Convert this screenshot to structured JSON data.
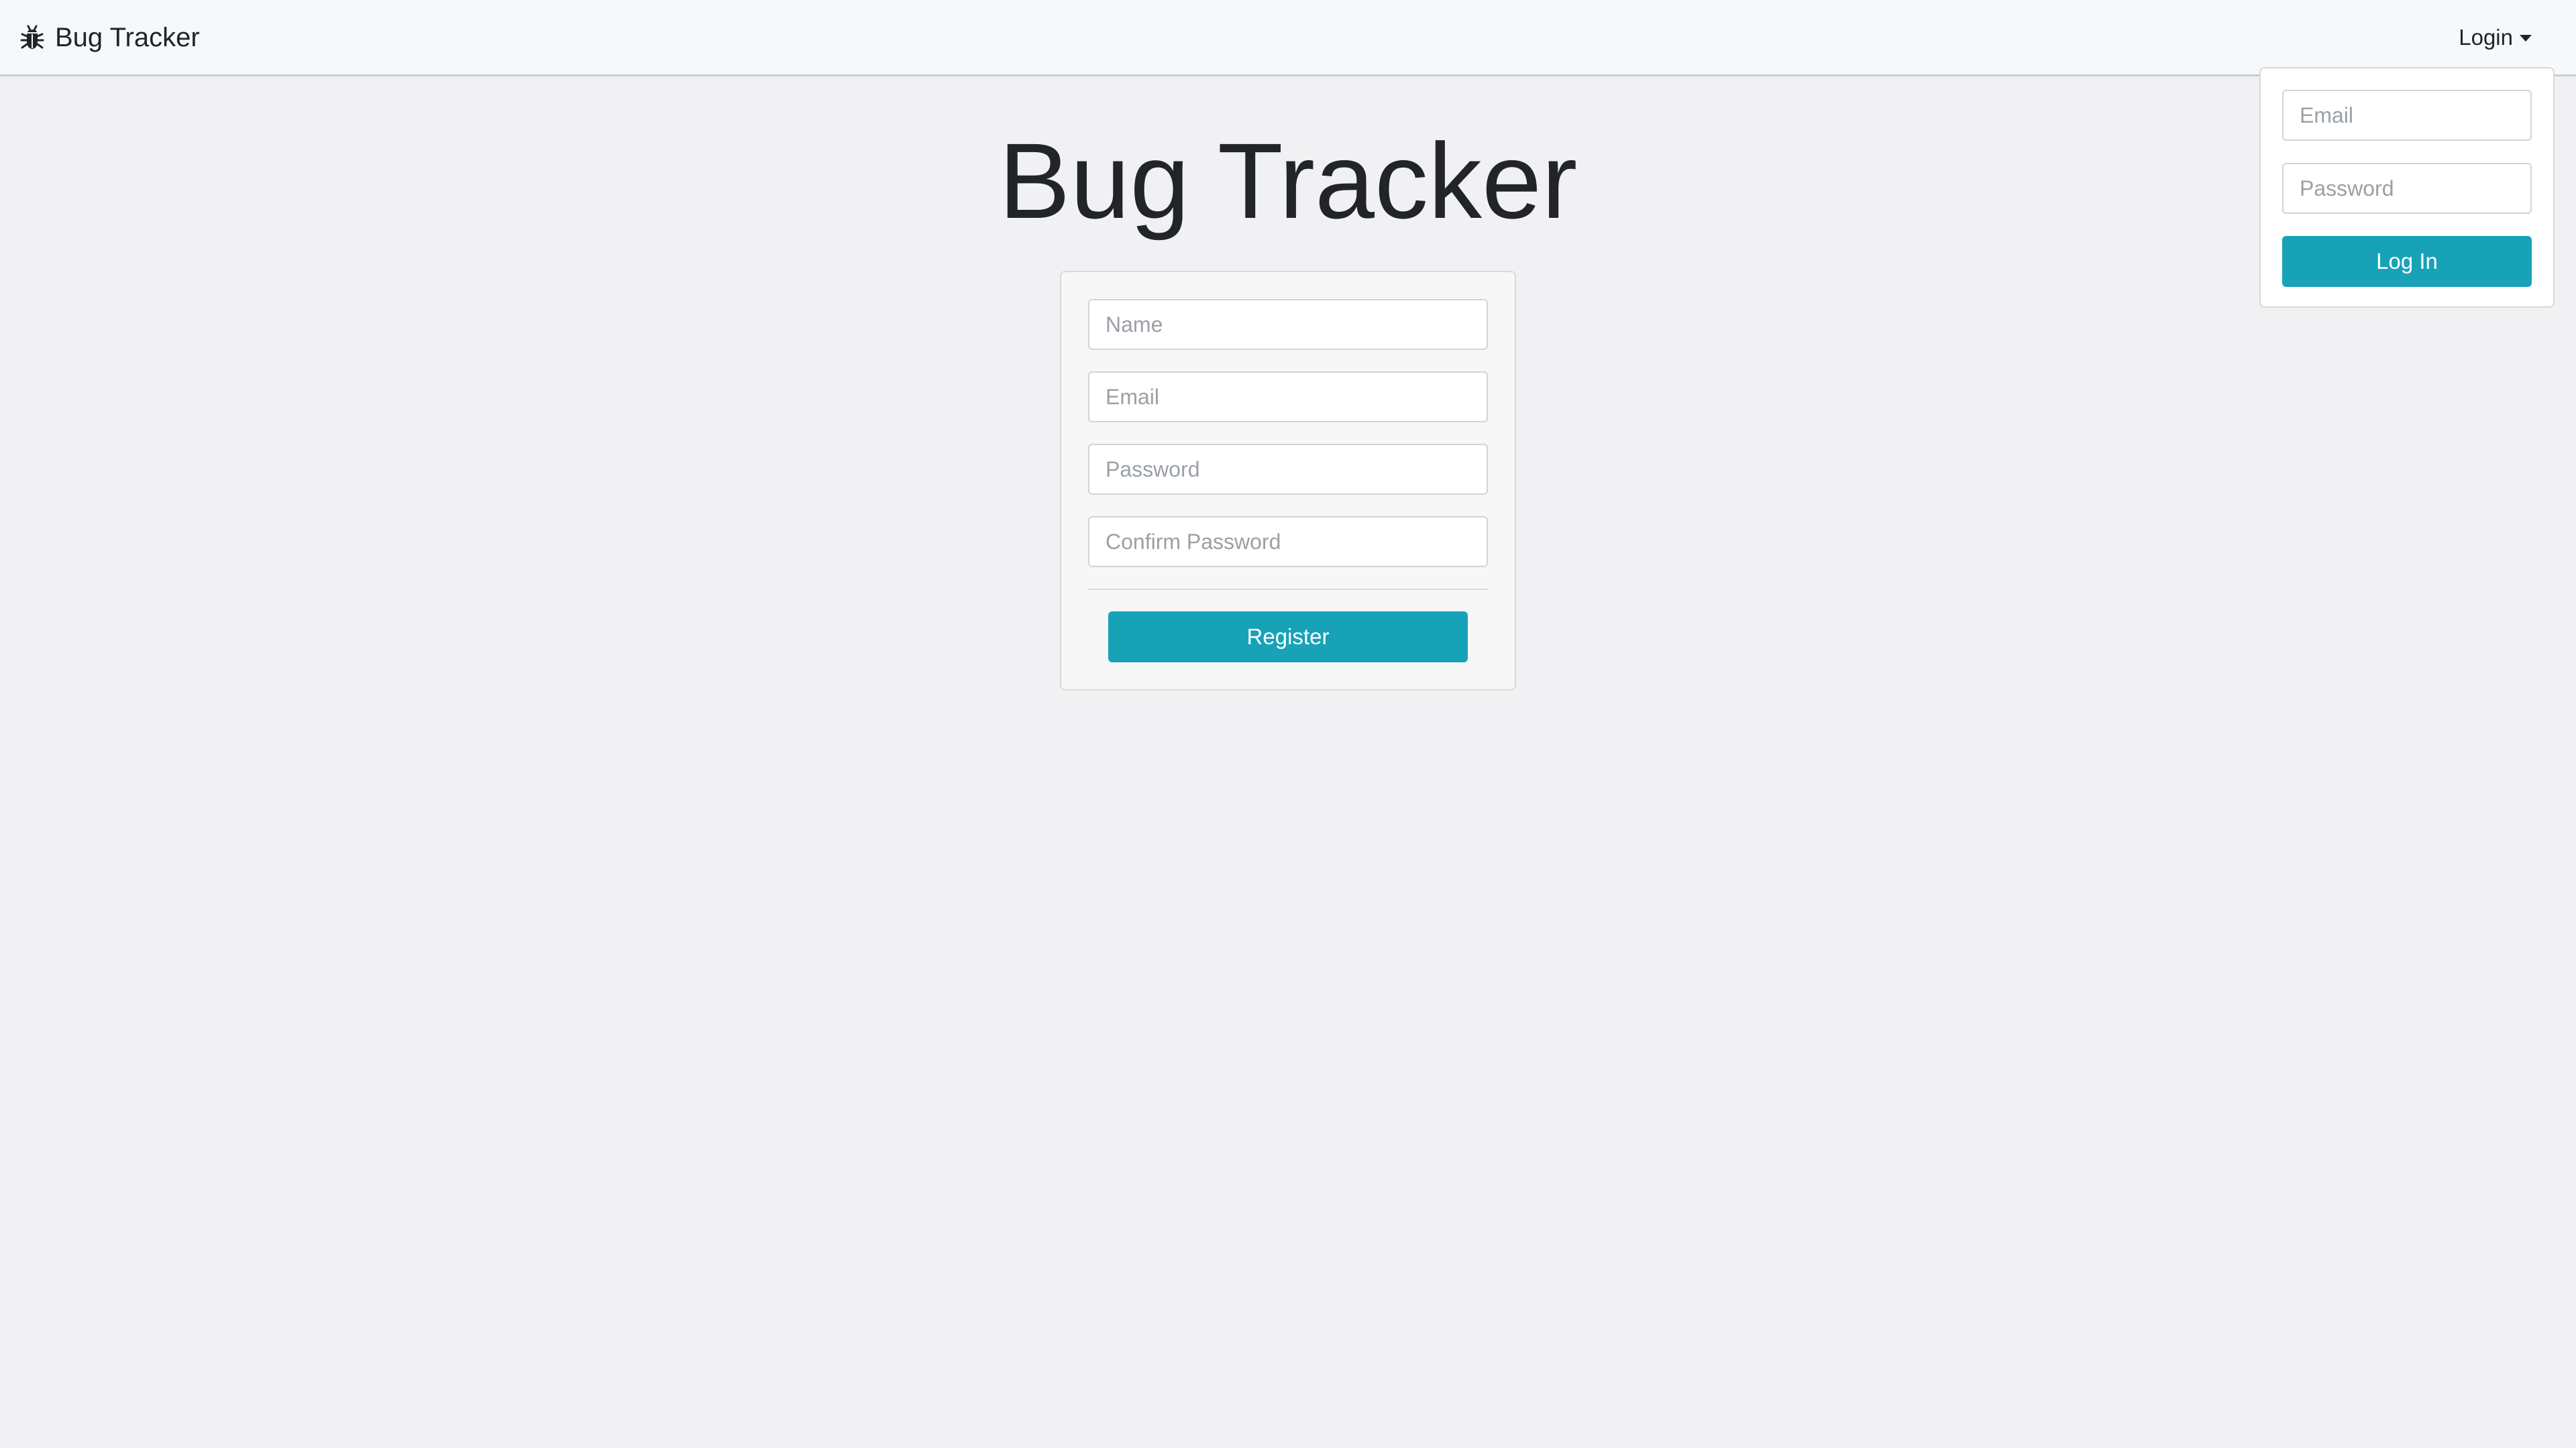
{
  "navbar": {
    "brand_icon": "bug-icon",
    "brand_text": "Bug Tracker",
    "login_toggle_label": "Login",
    "login_toggle_icon": "caret-down-icon"
  },
  "login_dropdown": {
    "email_placeholder": "Email",
    "password_placeholder": "Password",
    "submit_label": "Log In"
  },
  "main": {
    "title": "Bug Tracker",
    "register_form": {
      "name_placeholder": "Name",
      "email_placeholder": "Email",
      "password_placeholder": "Password",
      "confirm_password_placeholder": "Confirm Password",
      "submit_label": "Register"
    }
  },
  "colors": {
    "accent": "#17a2b8",
    "background": "#f1f1f3",
    "navbar": "#f7f8f9",
    "text": "#212529"
  }
}
